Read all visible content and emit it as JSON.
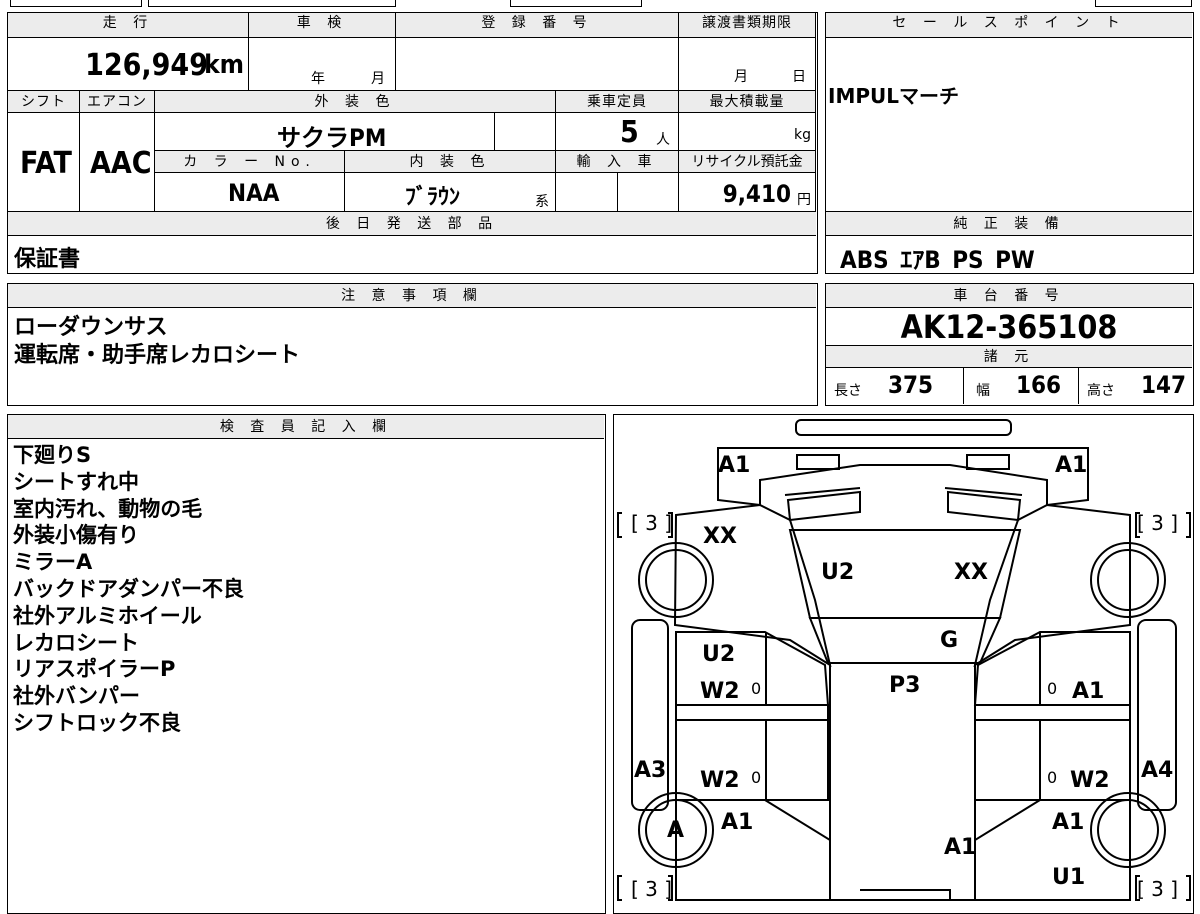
{
  "left_top": {
    "mileage_label": "走 行",
    "mileage_value": "126,949",
    "mileage_unit": "km",
    "inspection_label": "車 検",
    "inspection_year": "年",
    "inspection_month": "月",
    "reg_label": "登 録 番 号",
    "transfer_label": "譲渡書類期限",
    "transfer_month": "月",
    "transfer_day": "日",
    "shift_label": "シフト",
    "aircon_label": "エアコン",
    "exterior_label": "外 装 色",
    "capacity_label": "乗車定員",
    "loading_label": "最大積載量",
    "shift_value": "FAT",
    "aircon_value": "AAC",
    "exterior_value": "サクラPM",
    "capacity_value": "5",
    "capacity_unit": "人",
    "loading_unit": "kg",
    "color_no_label": "カ ラ ー No.",
    "interior_label": "内 装 色",
    "import_label": "輸 入 車",
    "recycle_label": "リサイクル預託金",
    "color_no_value": "NAA",
    "interior_value": "ﾌﾞﾗｳﾝ",
    "interior_suffix": "系",
    "recycle_value": "9,410",
    "recycle_unit": "円",
    "later_label": "後 日 発 送 部 品",
    "later_value": "保証書"
  },
  "sales_point": {
    "label": "セ ー ル ス ポ イ ン ト",
    "value": "IMPULマーチ"
  },
  "standard_equipment": {
    "label": "純 正 装 備",
    "value": "ABS ｴｱB PS PW"
  },
  "notes": {
    "label": "注 意 事 項 欄",
    "lines": [
      "ローダウンサス",
      "運転席・助手席レカロシート"
    ]
  },
  "chassis": {
    "label": "車 台 番 号",
    "value": "AK12-365108",
    "spec_label": "諸 元",
    "length_label": "長さ",
    "length_value": "375",
    "width_label": "幅",
    "width_value": "166",
    "height_label": "高さ",
    "height_value": "147"
  },
  "inspector": {
    "label": "検 査 員 記 入 欄",
    "lines": [
      "下廻りS",
      "シートすれ中",
      "室内汚れ、動物の毛",
      "外装小傷有り",
      "ミラーA",
      "バックドアダンパー不良",
      "社外アルミホイール",
      "レカロシート",
      "リアスポイラーP",
      "社外バンパー",
      "シフトロック不良"
    ]
  },
  "diagram": {
    "front_left": "A1",
    "front_right": "A1",
    "hood_left": "XX",
    "hood_center": "U2",
    "hood_right": "XX",
    "bracket_tl": "[ 3 ]",
    "bracket_tr": "[ 3 ]",
    "bracket_bl": "[ 3 ]",
    "bracket_br": "[ 3 ]",
    "windshield": "G",
    "roof": "P3",
    "left_front_u": "U2",
    "left_front_w": "W2",
    "left_rear_w": "W2",
    "right_front_a": "A1",
    "right_rear_w": "W2",
    "left_step": "A3",
    "right_step": "A4",
    "left_wheel": "A",
    "left_rear_a": "A1",
    "right_rear_a": "A1",
    "rear_center": "A1",
    "right_rear_u": "U1",
    "zero": "0"
  }
}
